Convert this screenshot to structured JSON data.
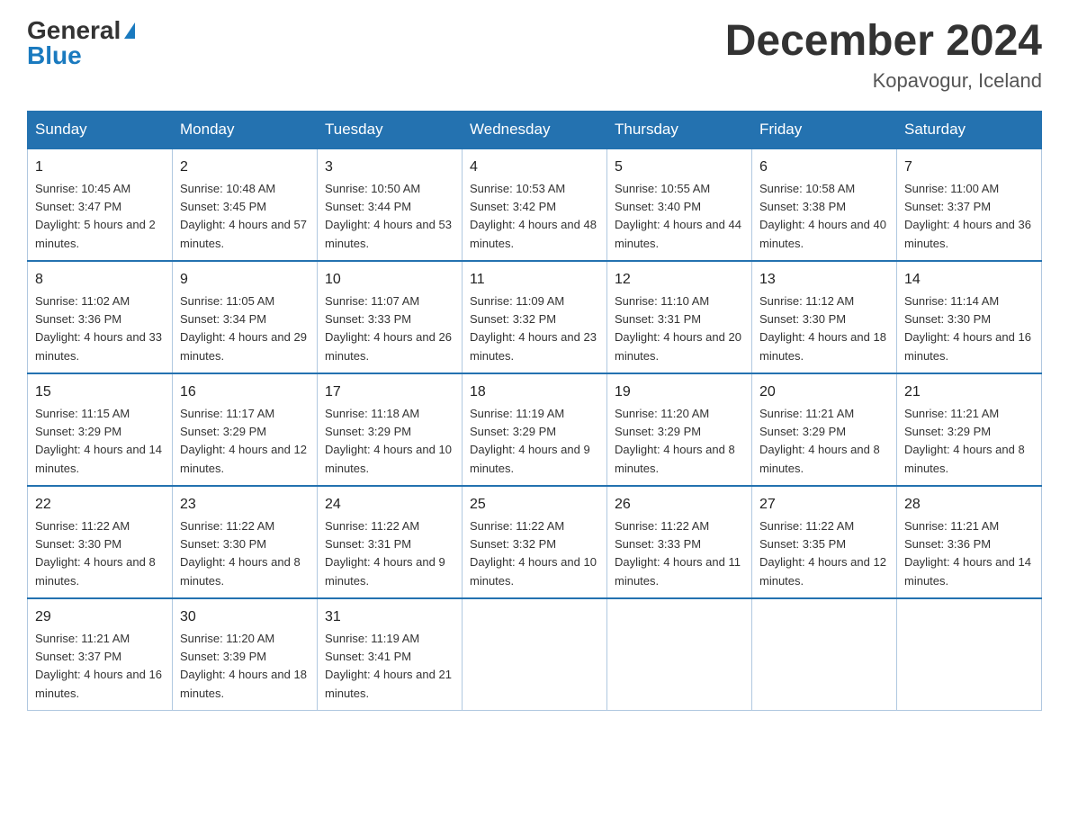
{
  "header": {
    "logo_general": "General",
    "logo_blue": "Blue",
    "title": "December 2024",
    "location": "Kopavogur, Iceland"
  },
  "weekdays": [
    "Sunday",
    "Monday",
    "Tuesday",
    "Wednesday",
    "Thursday",
    "Friday",
    "Saturday"
  ],
  "weeks": [
    [
      {
        "day": "1",
        "sunrise": "10:45 AM",
        "sunset": "3:47 PM",
        "daylight": "5 hours and 2 minutes."
      },
      {
        "day": "2",
        "sunrise": "10:48 AM",
        "sunset": "3:45 PM",
        "daylight": "4 hours and 57 minutes."
      },
      {
        "day": "3",
        "sunrise": "10:50 AM",
        "sunset": "3:44 PM",
        "daylight": "4 hours and 53 minutes."
      },
      {
        "day": "4",
        "sunrise": "10:53 AM",
        "sunset": "3:42 PM",
        "daylight": "4 hours and 48 minutes."
      },
      {
        "day": "5",
        "sunrise": "10:55 AM",
        "sunset": "3:40 PM",
        "daylight": "4 hours and 44 minutes."
      },
      {
        "day": "6",
        "sunrise": "10:58 AM",
        "sunset": "3:38 PM",
        "daylight": "4 hours and 40 minutes."
      },
      {
        "day": "7",
        "sunrise": "11:00 AM",
        "sunset": "3:37 PM",
        "daylight": "4 hours and 36 minutes."
      }
    ],
    [
      {
        "day": "8",
        "sunrise": "11:02 AM",
        "sunset": "3:36 PM",
        "daylight": "4 hours and 33 minutes."
      },
      {
        "day": "9",
        "sunrise": "11:05 AM",
        "sunset": "3:34 PM",
        "daylight": "4 hours and 29 minutes."
      },
      {
        "day": "10",
        "sunrise": "11:07 AM",
        "sunset": "3:33 PM",
        "daylight": "4 hours and 26 minutes."
      },
      {
        "day": "11",
        "sunrise": "11:09 AM",
        "sunset": "3:32 PM",
        "daylight": "4 hours and 23 minutes."
      },
      {
        "day": "12",
        "sunrise": "11:10 AM",
        "sunset": "3:31 PM",
        "daylight": "4 hours and 20 minutes."
      },
      {
        "day": "13",
        "sunrise": "11:12 AM",
        "sunset": "3:30 PM",
        "daylight": "4 hours and 18 minutes."
      },
      {
        "day": "14",
        "sunrise": "11:14 AM",
        "sunset": "3:30 PM",
        "daylight": "4 hours and 16 minutes."
      }
    ],
    [
      {
        "day": "15",
        "sunrise": "11:15 AM",
        "sunset": "3:29 PM",
        "daylight": "4 hours and 14 minutes."
      },
      {
        "day": "16",
        "sunrise": "11:17 AM",
        "sunset": "3:29 PM",
        "daylight": "4 hours and 12 minutes."
      },
      {
        "day": "17",
        "sunrise": "11:18 AM",
        "sunset": "3:29 PM",
        "daylight": "4 hours and 10 minutes."
      },
      {
        "day": "18",
        "sunrise": "11:19 AM",
        "sunset": "3:29 PM",
        "daylight": "4 hours and 9 minutes."
      },
      {
        "day": "19",
        "sunrise": "11:20 AM",
        "sunset": "3:29 PM",
        "daylight": "4 hours and 8 minutes."
      },
      {
        "day": "20",
        "sunrise": "11:21 AM",
        "sunset": "3:29 PM",
        "daylight": "4 hours and 8 minutes."
      },
      {
        "day": "21",
        "sunrise": "11:21 AM",
        "sunset": "3:29 PM",
        "daylight": "4 hours and 8 minutes."
      }
    ],
    [
      {
        "day": "22",
        "sunrise": "11:22 AM",
        "sunset": "3:30 PM",
        "daylight": "4 hours and 8 minutes."
      },
      {
        "day": "23",
        "sunrise": "11:22 AM",
        "sunset": "3:30 PM",
        "daylight": "4 hours and 8 minutes."
      },
      {
        "day": "24",
        "sunrise": "11:22 AM",
        "sunset": "3:31 PM",
        "daylight": "4 hours and 9 minutes."
      },
      {
        "day": "25",
        "sunrise": "11:22 AM",
        "sunset": "3:32 PM",
        "daylight": "4 hours and 10 minutes."
      },
      {
        "day": "26",
        "sunrise": "11:22 AM",
        "sunset": "3:33 PM",
        "daylight": "4 hours and 11 minutes."
      },
      {
        "day": "27",
        "sunrise": "11:22 AM",
        "sunset": "3:35 PM",
        "daylight": "4 hours and 12 minutes."
      },
      {
        "day": "28",
        "sunrise": "11:21 AM",
        "sunset": "3:36 PM",
        "daylight": "4 hours and 14 minutes."
      }
    ],
    [
      {
        "day": "29",
        "sunrise": "11:21 AM",
        "sunset": "3:37 PM",
        "daylight": "4 hours and 16 minutes."
      },
      {
        "day": "30",
        "sunrise": "11:20 AM",
        "sunset": "3:39 PM",
        "daylight": "4 hours and 18 minutes."
      },
      {
        "day": "31",
        "sunrise": "11:19 AM",
        "sunset": "3:41 PM",
        "daylight": "4 hours and 21 minutes."
      },
      null,
      null,
      null,
      null
    ]
  ]
}
